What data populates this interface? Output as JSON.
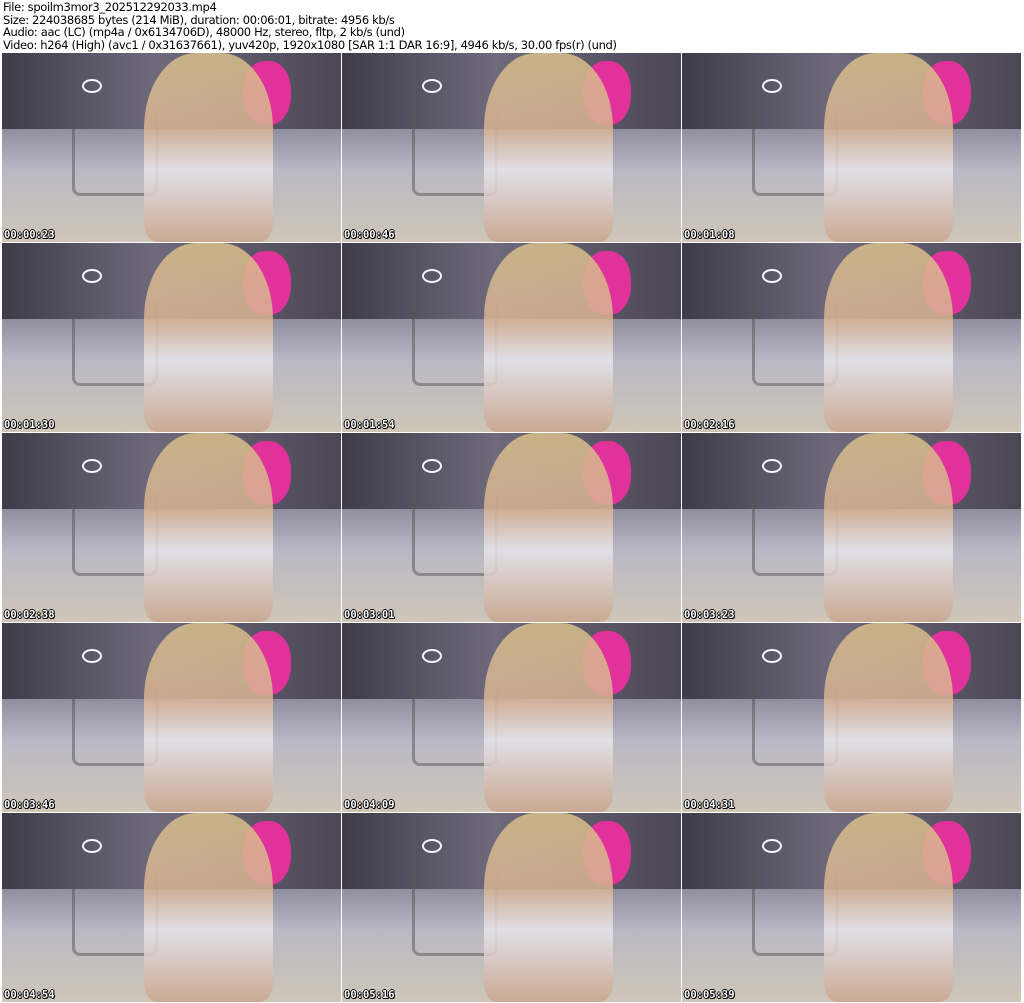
{
  "header": {
    "file": "File: spoilm3mor3_202512292033.mp4",
    "size": "Size: 224038685 bytes (214 MiB), duration: 00:06:01, bitrate: 4956 kb/s",
    "audio": "Audio: aac (LC) (mp4a / 0x6134706D), 48000 Hz, stereo, fltp, 2 kb/s (und)",
    "video": "Video: h264 (High) (avc1 / 0x31637661), yuv420p, 1920x1080 [SAR 1:1 DAR 16:9], 4946 kb/s, 30.00 fps(r) (und)"
  },
  "thumbnails": [
    {
      "timestamp": "00:00:23"
    },
    {
      "timestamp": "00:00:46"
    },
    {
      "timestamp": "00:01:08"
    },
    {
      "timestamp": "00:01:30"
    },
    {
      "timestamp": "00:01:54"
    },
    {
      "timestamp": "00:02:16"
    },
    {
      "timestamp": "00:02:38"
    },
    {
      "timestamp": "00:03:01"
    },
    {
      "timestamp": "00:03:23"
    },
    {
      "timestamp": "00:03:46"
    },
    {
      "timestamp": "00:04:09"
    },
    {
      "timestamp": "00:04:31"
    },
    {
      "timestamp": "00:04:54"
    },
    {
      "timestamp": "00:05:16"
    },
    {
      "timestamp": "00:05:39"
    }
  ]
}
